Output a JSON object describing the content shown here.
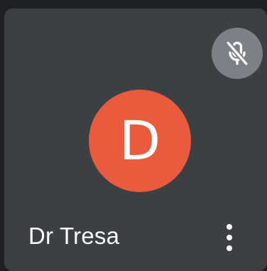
{
  "participant": {
    "initial": "D",
    "name": "Dr Tresa",
    "avatar_color": "#ea5a3c",
    "mic_status": "muted"
  },
  "icons": {
    "mic": "mic-off-icon",
    "more": "more-vertical-icon"
  },
  "colors": {
    "tile_background": "#3c4043",
    "mic_badge": "#7d8185"
  }
}
